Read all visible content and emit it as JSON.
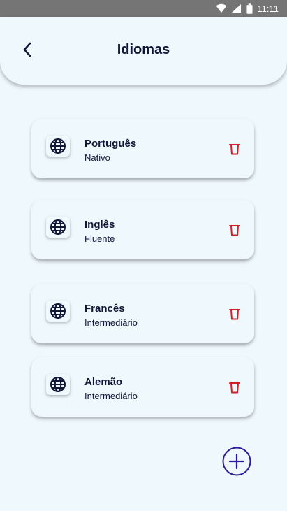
{
  "status_bar": {
    "time": "11:11"
  },
  "header": {
    "title": "Idiomas"
  },
  "languages": [
    {
      "name": "Português",
      "level": "Nativo"
    },
    {
      "name": "Inglês",
      "level": "Fluente"
    },
    {
      "name": "Francês",
      "level": "Intermediário"
    },
    {
      "name": "Alemão",
      "level": "Intermediário"
    }
  ],
  "colors": {
    "background": "#eef8fd",
    "text": "#121638",
    "delete": "#d0202a",
    "accent": "#2e1a9e",
    "status_bar": "#757575"
  },
  "icons": {
    "back": "chevron-left-icon",
    "language": "globe-icon",
    "delete": "trash-icon",
    "add": "plus-circle-icon"
  }
}
